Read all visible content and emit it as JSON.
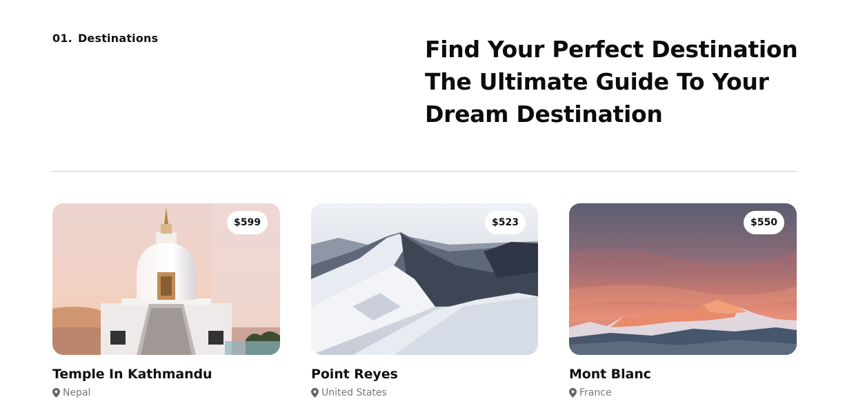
{
  "section": {
    "number": "01.",
    "label": "Destinations"
  },
  "headline": {
    "line1": "Find Your Perfect Destination",
    "line2": "The Ultimate Guide To Your",
    "line3": "Dream Destination"
  },
  "cards": [
    {
      "title": "Temple In Kathmandu",
      "location": "Nepal",
      "price": "$599",
      "image": "white stupa temple at sunset"
    },
    {
      "title": "Point Reyes",
      "location": "United States",
      "price": "$523",
      "image": "snowy mountain ridge"
    },
    {
      "title": "Mont Blanc",
      "location": "France",
      "price": "$550",
      "image": "mountains under pink sunset sky"
    }
  ],
  "icons": {
    "location": "map-pin-icon"
  },
  "colors": {
    "text": "#111111",
    "muted": "#777777",
    "divider": "#c9c9c9",
    "badge_bg": "#ffffff"
  }
}
